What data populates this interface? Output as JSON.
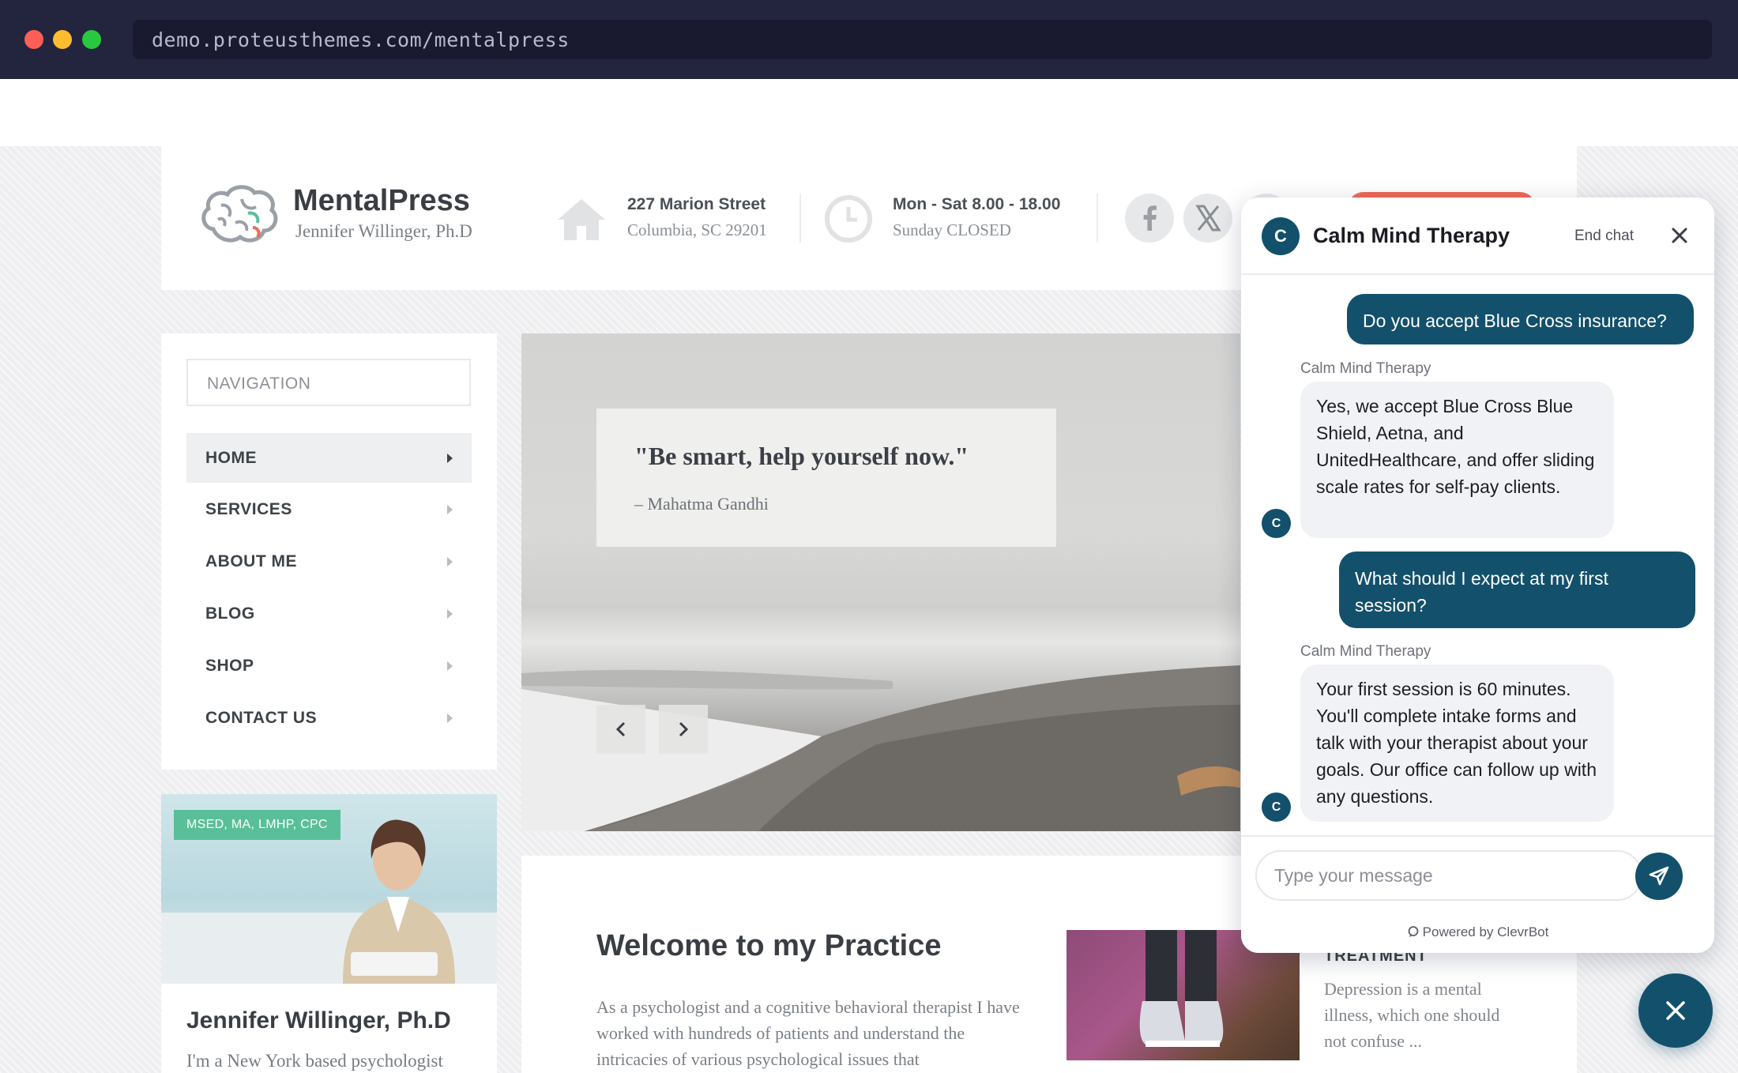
{
  "browser": {
    "url": "demo.proteusthemes.com/mentalpress",
    "traffic_lights": [
      "#ff5f57",
      "#febc2e",
      "#28c840"
    ]
  },
  "site": {
    "brand_name": "MentalPress",
    "brand_sub": "Jennifer Willinger, Ph.D",
    "address_line1": "227 Marion Street",
    "address_line2": "Columbia, SC 29201",
    "hours_line1": "Mon - Sat 8.00 - 18.00",
    "hours_line2": "Sunday CLOSED",
    "icons": [
      "brain-logo-icon",
      "home-icon",
      "clock-icon",
      "facebook-icon",
      "x-twitter-icon"
    ]
  },
  "nav": {
    "title": "NAVIGATION",
    "items": [
      {
        "label": "HOME"
      },
      {
        "label": "SERVICES"
      },
      {
        "label": "ABOUT ME"
      },
      {
        "label": "BLOG"
      },
      {
        "label": "SHOP"
      },
      {
        "label": "CONTACT US"
      }
    ]
  },
  "profile": {
    "badge": "MSED, MA, LMHP, CPC",
    "name": "Jennifer Willinger, Ph.D",
    "description": "I'm a New York based psychologist"
  },
  "hero": {
    "quote": "\"Be smart, help yourself now.\"",
    "author": "– Mahatma Gandhi"
  },
  "content": {
    "title": "Welcome to my Practice",
    "text": "As a psychologist and a cognitive behavioral therapist I have worked with hundreds of patients and understand the intricacies of various psychological issues that",
    "feature_label": "TREATMENT",
    "feature_text": "Depression is a mental illness, which one should not confuse ..."
  },
  "chat": {
    "avatar_letter": "C",
    "title": "Calm Mind Therapy",
    "end_chat": "End chat",
    "messages": [
      {
        "from": "user",
        "text": "Do you accept Blue Cross insurance?"
      },
      {
        "from": "bot",
        "sender": "Calm Mind Therapy",
        "text": "Yes, we accept Blue Cross Blue Shield, Aetna, and UnitedHealthcare, and offer sliding scale rates for self-pay clients."
      },
      {
        "from": "user",
        "text": "What should I expect at my first session?"
      },
      {
        "from": "bot",
        "sender": "Calm Mind Therapy",
        "text": "Your first session is 60 minutes. You'll complete intake forms and talk with your therapist about your goals. Our office can follow up with any questions."
      }
    ],
    "input_placeholder": "Type your message",
    "powered_by": "Powered by ClevrBot",
    "accent_color": "#13506b"
  }
}
